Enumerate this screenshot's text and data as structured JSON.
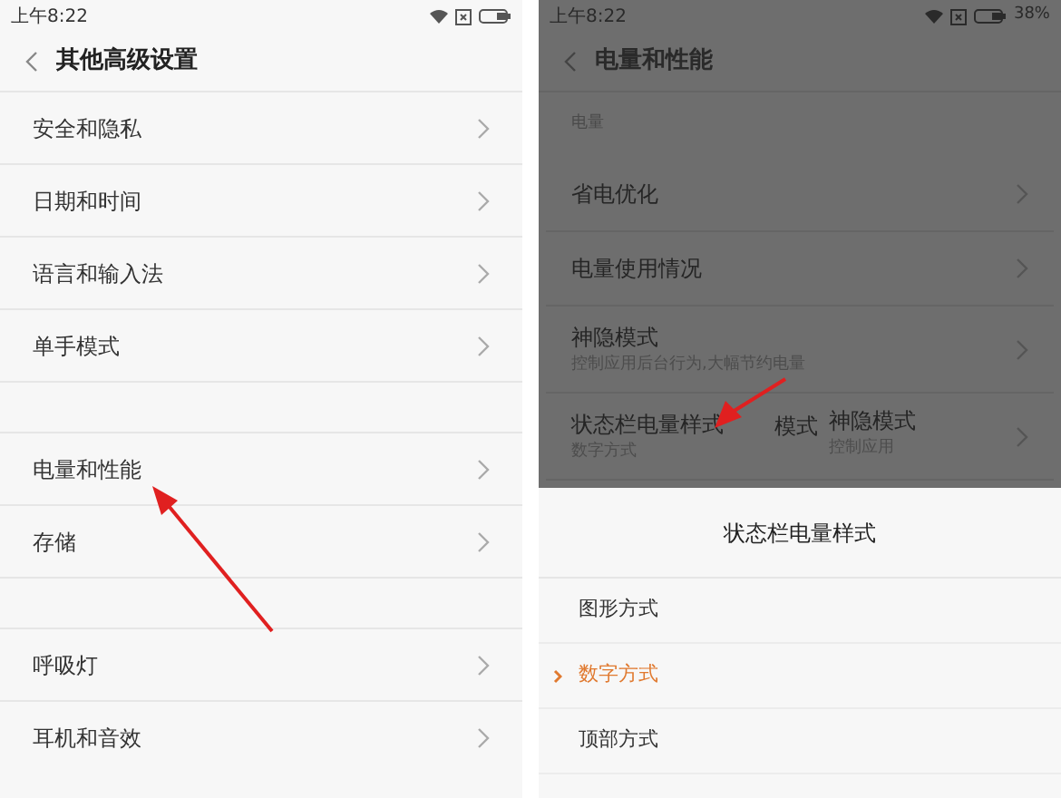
{
  "left_screen": {
    "status_bar": {
      "time": "上午8:22"
    },
    "header": {
      "title": "其他高级设置"
    },
    "groups": [
      {
        "items": [
          {
            "label": "安全和隐私"
          },
          {
            "label": "日期和时间"
          },
          {
            "label": "语言和输入法"
          },
          {
            "label": "单手模式"
          }
        ]
      },
      {
        "items": [
          {
            "label": "电量和性能"
          },
          {
            "label": "存储"
          }
        ]
      },
      {
        "items": [
          {
            "label": "呼吸灯"
          },
          {
            "label": "耳机和音效"
          }
        ]
      }
    ]
  },
  "right_screen": {
    "status_bar": {
      "time": "上午8:22",
      "battery": "38%"
    },
    "header": {
      "title": "电量和性能"
    },
    "section": "电量",
    "items": [
      {
        "label": "省电优化"
      },
      {
        "label": "电量使用情况"
      },
      {
        "label": "神隐模式",
        "subtitle": "控制应用后台行为,大幅节约电量"
      },
      {
        "label": "状态栏电量样式",
        "subtitle": "数字方式",
        "ghost": [
          "模式",
          "神隐模式",
          "控制应用"
        ]
      }
    ],
    "sheet": {
      "title": "状态栏电量样式",
      "options": [
        {
          "label": "图形方式",
          "selected": false
        },
        {
          "label": "数字方式",
          "selected": true
        },
        {
          "label": "顶部方式",
          "selected": false
        }
      ]
    }
  }
}
